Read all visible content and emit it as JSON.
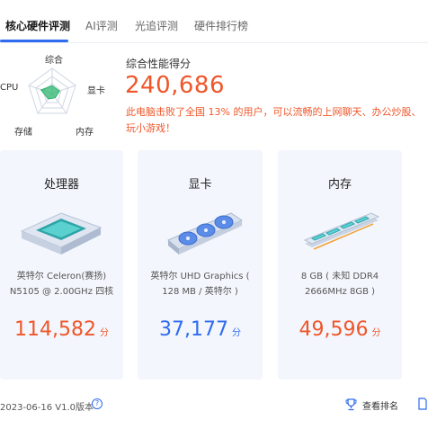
{
  "tabs": [
    {
      "label": "核心硬件评测",
      "active": true
    },
    {
      "label": "AI评测",
      "active": false
    },
    {
      "label": "光追评测",
      "active": false
    },
    {
      "label": "硬件排行榜",
      "active": false
    }
  ],
  "radar": {
    "labels": {
      "top": "综合",
      "left": "CPU",
      "right": "显卡",
      "bottom_left": "存储",
      "bottom_right": "内存"
    },
    "values": [
      0.3,
      0.3,
      0.2,
      0.25,
      0.45
    ]
  },
  "score": {
    "title": "综合性能得分",
    "value": "240,686",
    "description": "此电脑击败了全国 13% 的用户，可以流畅的上网聊天、办公炒股、玩小游戏！"
  },
  "cards": [
    {
      "title": "处理器",
      "desc_line1": "英特尔 Celeron(赛扬)",
      "desc_line2": "N5105 @ 2.00GHz 四核",
      "score": "114,582",
      "unit": "分",
      "score_color": "#f0562a"
    },
    {
      "title": "显卡",
      "desc_line1": "英特尔 UHD Graphics (",
      "desc_line2": "128 MB / 英特尔 )",
      "score": "37,177",
      "unit": "分",
      "score_color": "#2f6bf0"
    },
    {
      "title": "内存",
      "desc_line1": "8 GB ( 未知 DDR4",
      "desc_line2": "2666MHz 8GB )",
      "score": "49,596",
      "unit": "分",
      "score_color": "#f0562a"
    }
  ],
  "footer": {
    "version": "2023-06-16 V1.0版本",
    "help": "?",
    "rank_label": "查看排名"
  },
  "colors": {
    "accent": "#2f6bf0",
    "score": "#f0562a",
    "card_bg": "#f3f6fc",
    "radar_fill": "#2db56d"
  }
}
